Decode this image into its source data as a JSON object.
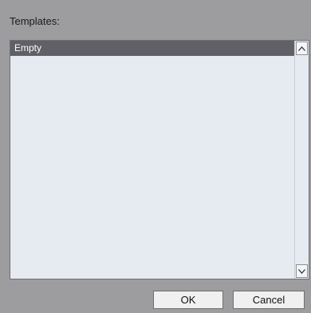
{
  "dialog": {
    "templates_label": "Templates:",
    "items": [
      {
        "label": "Empty",
        "selected": true
      }
    ],
    "scrollbar": {
      "up_icon": "chevron-up-icon",
      "down_icon": "chevron-down-icon"
    },
    "buttons": {
      "ok_label": "OK",
      "cancel_label": "Cancel"
    }
  }
}
